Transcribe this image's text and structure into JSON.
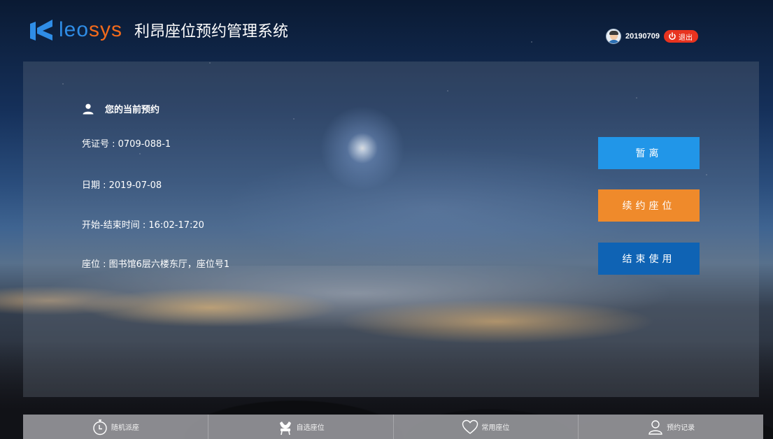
{
  "header": {
    "logo_part1": "leo",
    "logo_part2": "sys",
    "title": "利昂座位预约管理系统",
    "username": "20190709",
    "logout_label": "退出"
  },
  "reservation": {
    "title": "您的当前预约",
    "voucher": "凭证号 : 0709-088-1",
    "date": "日期 : 2019-07-08",
    "time": "开始-结束时间 : 16:02-17:20",
    "seat": "座位 : 图书馆6层六楼东厅，座位号1"
  },
  "actions": {
    "away": "暂离",
    "renew": "续约座位",
    "end": "结束使用"
  },
  "tabs": [
    {
      "label": "随机派座",
      "icon": "stopwatch-icon"
    },
    {
      "label": "自选座位",
      "icon": "chair-icon"
    },
    {
      "label": "常用座位",
      "icon": "heart-icon"
    },
    {
      "label": "预约记录",
      "icon": "user-icon"
    }
  ],
  "colors": {
    "logo_blue": "#2f8de6",
    "logo_orange": "#f26a1b",
    "away_button": "#2196e8",
    "renew_button": "#ef8a2b",
    "end_button": "#0f63b4",
    "logout_button": "#e8331f"
  }
}
